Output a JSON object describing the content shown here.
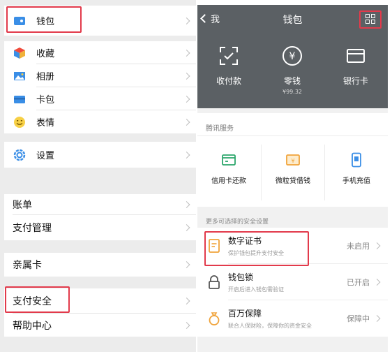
{
  "left": {
    "items": [
      {
        "label": "钱包",
        "icon": "wallet-icon"
      },
      {
        "label": "收藏",
        "icon": "favorites-icon"
      },
      {
        "label": "相册",
        "icon": "album-icon"
      },
      {
        "label": "卡包",
        "icon": "card-pack-icon"
      },
      {
        "label": "表情",
        "icon": "sticker-icon"
      },
      {
        "label": "设置",
        "icon": "settings-icon"
      }
    ],
    "plain_items": [
      {
        "label": "账单"
      },
      {
        "label": "支付管理"
      },
      {
        "label": "亲属卡"
      },
      {
        "label": "支付安全"
      },
      {
        "label": "帮助中心"
      }
    ]
  },
  "wallet": {
    "back_label": "我",
    "title": "钱包",
    "tiles": [
      {
        "label": "收付款",
        "icon": "scan-qr-icon"
      },
      {
        "label": "零钱",
        "icon": "yuan-icon",
        "amount": "¥99.32"
      },
      {
        "label": "银行卡",
        "icon": "bank-card-icon"
      }
    ],
    "services_title": "腾讯服务",
    "services": [
      {
        "label": "信用卡还款",
        "icon": "credit-card-icon"
      },
      {
        "label": "微粒贷借钱",
        "icon": "loan-icon"
      },
      {
        "label": "手机充值",
        "icon": "phone-topup-icon"
      }
    ],
    "security_title": "更多可选择的安全设置",
    "security_items": [
      {
        "title": "数字证书",
        "subtitle": "保护钱包提升支付安全",
        "status": "未启用",
        "icon": "certificate-icon"
      },
      {
        "title": "钱包锁",
        "subtitle": "开启后进入钱包需验证",
        "status": "已开启",
        "icon": "lock-icon"
      },
      {
        "title": "百万保障",
        "subtitle": "联合人保财险，保障你的资金安全",
        "status": "保障中",
        "icon": "insurance-icon"
      }
    ]
  },
  "colors": {
    "highlight_box": "#e23a4b",
    "wallet_header": "#5b6064",
    "service_green": "#2ba66b",
    "service_orange": "#f0a33a",
    "service_blue": "#3a8ee6"
  }
}
